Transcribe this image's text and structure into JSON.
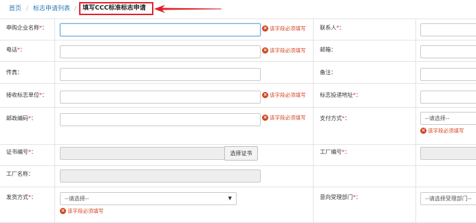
{
  "breadcrumb": {
    "home": "首页",
    "list": "标志申请列表",
    "current": "填写CCC标准标志申请",
    "separator": "/"
  },
  "error_text": "该字段必须填写",
  "fields": {
    "company_name": {
      "label": "申购企业名称",
      "required": "*",
      "colon": "："
    },
    "contact": {
      "label": "联系人",
      "required": "*",
      "colon": "："
    },
    "phone": {
      "label": "电话",
      "required": "*",
      "colon": "："
    },
    "email": {
      "label": "邮箱",
      "colon": "："
    },
    "fax": {
      "label": "传真",
      "colon": "："
    },
    "remark": {
      "label": "备注",
      "colon": "："
    },
    "receiving_unit": {
      "label": "接收标志单位",
      "required": "*",
      "colon": "："
    },
    "delivery_address": {
      "label": "标志投递地址",
      "required": "*",
      "colon": "："
    },
    "postal_code": {
      "label": "邮政编码",
      "required": "*",
      "colon": "："
    },
    "payment_method": {
      "label": "支付方式",
      "required": "*",
      "colon": "：",
      "placeholder": "--请选择--"
    },
    "certificate_no": {
      "label": "证书编号",
      "required": "*",
      "colon": "：",
      "button": "选择证书"
    },
    "factory_no": {
      "label": "工厂编号",
      "required": "*",
      "colon": "："
    },
    "factory_name": {
      "label": "工厂名称",
      "colon": "："
    },
    "shipping_method": {
      "label": "发货方式",
      "required": "*",
      "colon": "：",
      "placeholder": "--请选择--"
    },
    "intended_dept": {
      "label": "意向受理部门",
      "required": "*",
      "colon": "：",
      "placeholder": "--请选择受理部门--"
    }
  },
  "colors": {
    "error": "#d4451f",
    "required": "#e2312d",
    "link": "#2a7ab8",
    "highlight": "#e0202a"
  },
  "icons": {
    "error": "error-circle-icon",
    "caret": "caret-down-icon",
    "arrow": "left-arrow-annotation"
  }
}
